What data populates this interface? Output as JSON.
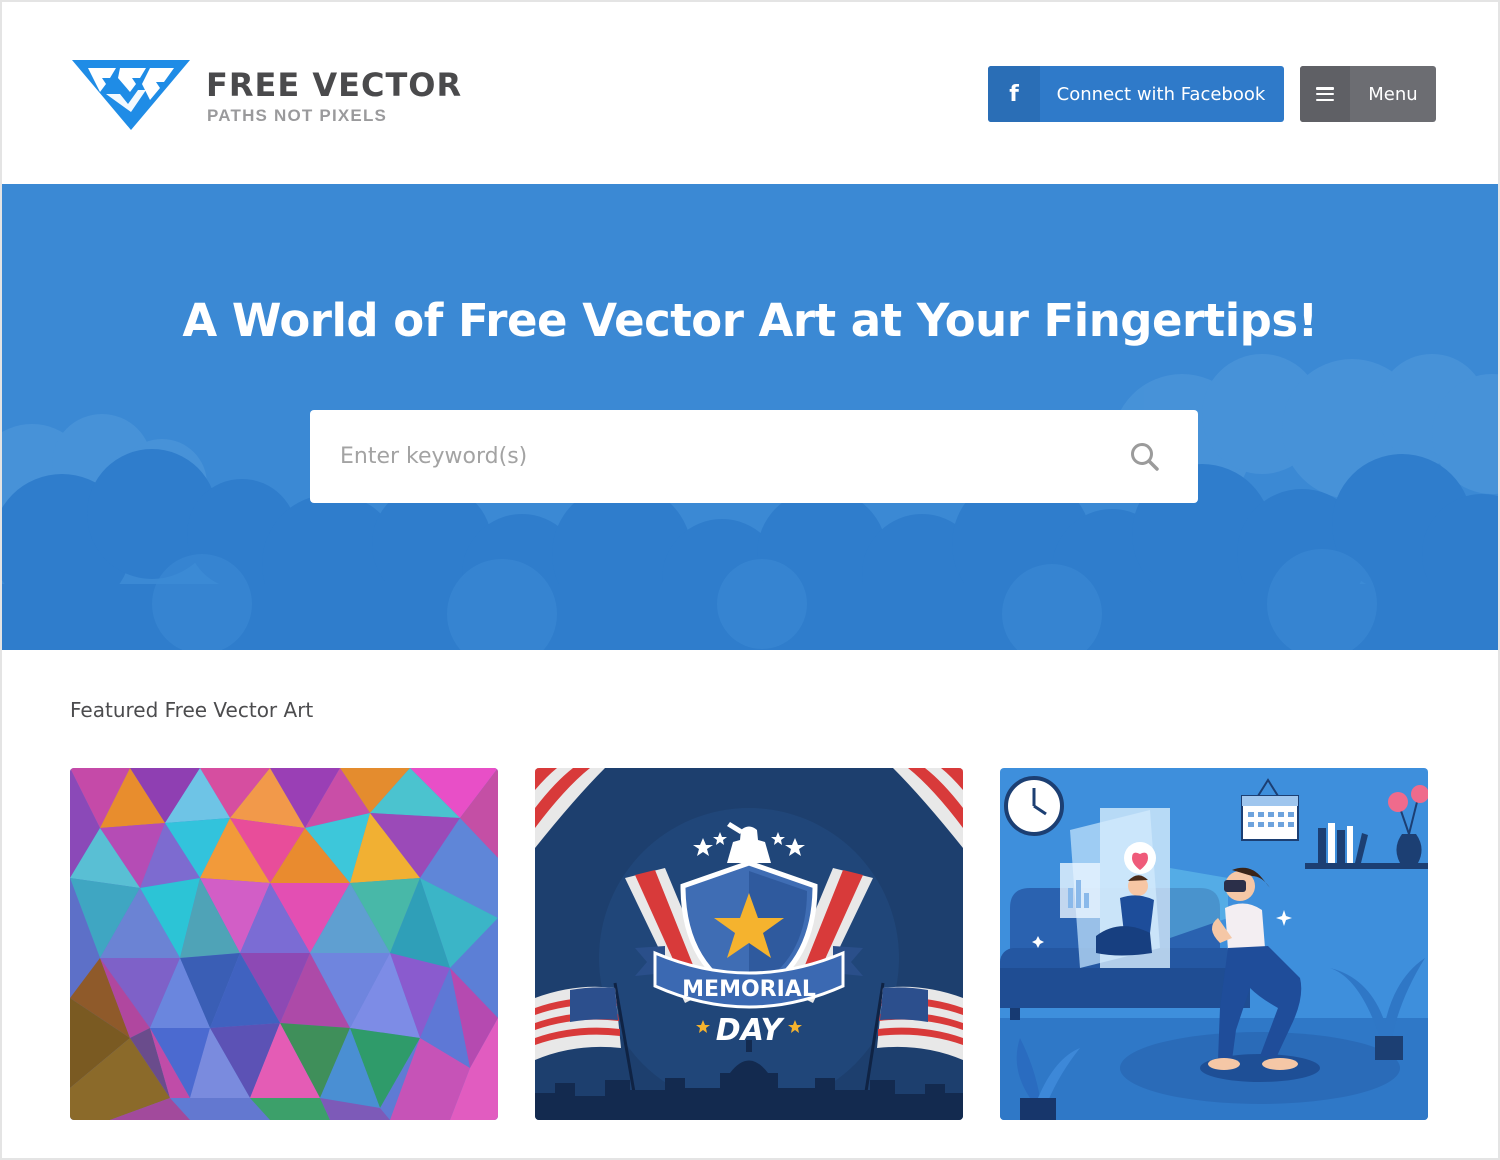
{
  "brand": {
    "title": "FREE VECTOR",
    "tagline": "PATHS NOT PIXELS",
    "color": "#1f8ce6"
  },
  "header": {
    "facebook_button": {
      "label": "Connect with Facebook",
      "icon": "facebook-icon",
      "glyph": "f"
    },
    "menu_button": {
      "label": "Menu",
      "icon": "hamburger-icon"
    }
  },
  "hero": {
    "title": "A World of Free Vector Art at Your Fingertips!",
    "background_color": "#3b89d4",
    "search": {
      "placeholder": "Enter keyword(s)",
      "value": "",
      "icon": "search-icon"
    }
  },
  "featured": {
    "title": "Featured Free Vector Art",
    "items": [
      {
        "kind": "low-poly colorful triangles background"
      },
      {
        "kind": "memorial day illustration",
        "text_top": "MEMORIAL",
        "text_bottom": "DAY"
      },
      {
        "kind": "virtual reality fitness workout illustration"
      }
    ]
  }
}
